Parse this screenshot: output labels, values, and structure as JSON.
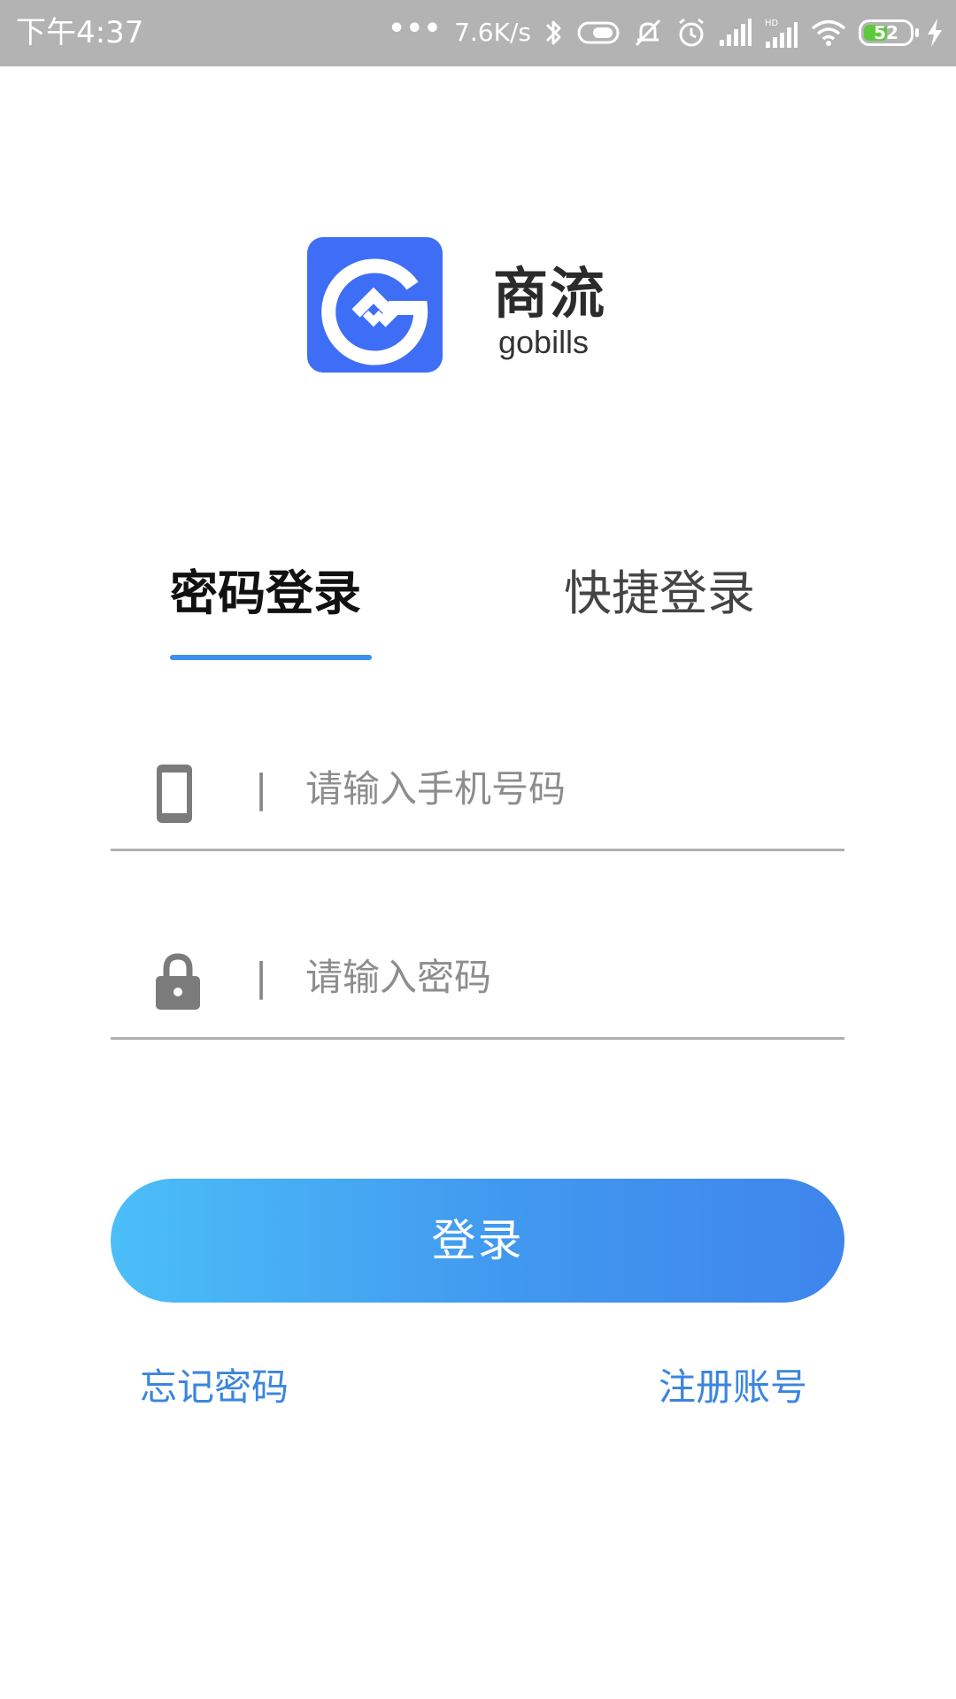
{
  "status_bar": {
    "time": "下午4:37",
    "dots": "•••",
    "network_speed": "7.6K/s",
    "battery_level": "52",
    "battery_fill_fraction": 0.52,
    "battery_fill_color": "#5ec93c",
    "icons": [
      "bluetooth-icon",
      "toggle-icon",
      "mute-icon",
      "alarm-icon",
      "signal-icon",
      "hd-signal-icon",
      "wifi-icon",
      "battery-icon",
      "charging-icon"
    ]
  },
  "brand": {
    "name": "商流",
    "sub": "gobills",
    "logo_color": "#3f6ef6",
    "logo_icon": "gobills-logo-icon"
  },
  "tabs": [
    {
      "label": "密码登录",
      "active": true
    },
    {
      "label": "快捷登录",
      "active": false
    }
  ],
  "tab_indicator_color": "#3b8ff0",
  "fields": {
    "phone": {
      "icon": "phone-icon",
      "divider": "|",
      "placeholder": "请输入手机号码",
      "value": ""
    },
    "password": {
      "icon": "lock-icon",
      "divider": "|",
      "placeholder": "请输入密码",
      "value": ""
    }
  },
  "login_button": {
    "label": "登录",
    "gradient_start": "#4bbef8",
    "gradient_end": "#3f85ec"
  },
  "links": {
    "forgot_password": "忘记密码",
    "register": "注册账号",
    "color": "#3a85de"
  }
}
